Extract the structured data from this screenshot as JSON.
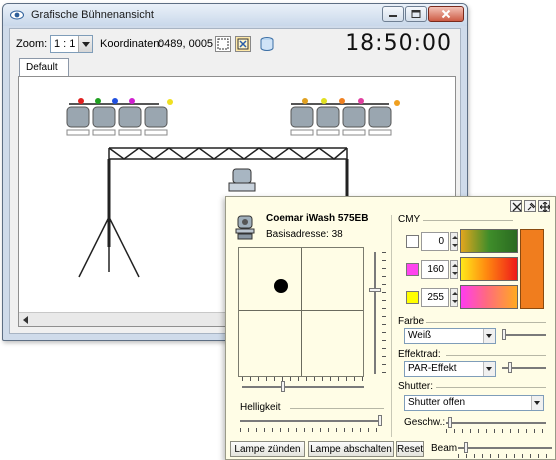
{
  "window": {
    "title": "Grafische Bühnenansicht",
    "zoom_label": "Zoom:",
    "zoom_value": "1 : 1",
    "coords_label": "Koordinaten:",
    "coords_value": "0489, 0005",
    "clock": "18:50:00",
    "tab_default": "Default"
  },
  "panel": {
    "fixture_name": "Coemar iWash 575EB",
    "base_address": "Basisadresse: 38",
    "brightness_label": "Helligkeit",
    "cmy_label": "CMY",
    "cmy": [
      {
        "value": "0",
        "swatch": "#ffffff"
      },
      {
        "value": "160",
        "swatch": "#ff44ee"
      },
      {
        "value": "255",
        "swatch": "#ffff00"
      }
    ],
    "color_label": "Farbe",
    "color_value": "Weiß",
    "effect_label": "Effektrad:",
    "effect_value": "PAR-Effekt",
    "shutter_label": "Shutter:",
    "shutter_value": "Shutter offen",
    "speed_label": "Geschw.:",
    "beam_label": "Beam",
    "buttons": {
      "lamp_on": "Lampe zünden",
      "lamp_off": "Lampe abschalten",
      "reset": "Reset"
    }
  }
}
